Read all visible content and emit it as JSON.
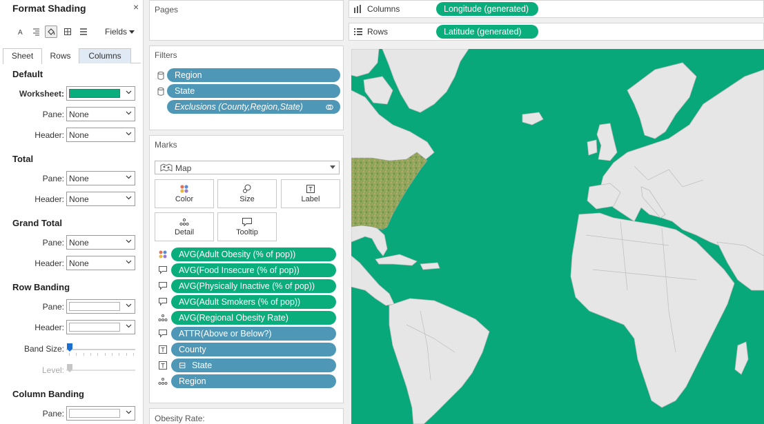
{
  "format_pane": {
    "title": "Format Shading",
    "close_symbol": "×",
    "toolbar": {
      "icons": [
        "font-icon",
        "alignment-icon",
        "shading-icon",
        "borders-icon",
        "lines-icon"
      ],
      "fields_label": "Fields"
    },
    "tabs": [
      "Sheet",
      "Rows",
      "Columns"
    ],
    "active_tab": "Sheet",
    "sections": {
      "default": {
        "title": "Default",
        "worksheet_label": "Worksheet:",
        "worksheet_color": "#0aae7c",
        "pane_label": "Pane:",
        "pane_value": "None",
        "header_label": "Header:",
        "header_value": "None"
      },
      "total": {
        "title": "Total",
        "pane_label": "Pane:",
        "pane_value": "None",
        "header_label": "Header:",
        "header_value": "None"
      },
      "grand_total": {
        "title": "Grand Total",
        "pane_label": "Pane:",
        "pane_value": "None",
        "header_label": "Header:",
        "header_value": "None"
      },
      "row_banding": {
        "title": "Row Banding",
        "pane_label": "Pane:",
        "header_label": "Header:",
        "band_size_label": "Band Size:",
        "level_label": "Level:"
      },
      "column_banding": {
        "title": "Column Banding",
        "pane_label": "Pane:"
      }
    }
  },
  "pages": {
    "title": "Pages"
  },
  "filters": {
    "title": "Filters",
    "items": [
      {
        "label": "Region",
        "icon": "database-icon"
      },
      {
        "label": "State",
        "icon": "database-icon"
      },
      {
        "label": "Exclusions (County,Region,State)",
        "icon": "set-icon"
      }
    ]
  },
  "marks": {
    "title": "Marks",
    "mark_type": "Map",
    "buttons": [
      "Color",
      "Size",
      "Label",
      "Detail",
      "Tooltip"
    ],
    "fields": [
      {
        "label": "AVG(Adult Obesity (% of pop))",
        "role": "color",
        "kind": "measure"
      },
      {
        "label": "AVG(Food Insecure (% of pop))",
        "role": "tooltip",
        "kind": "measure"
      },
      {
        "label": "AVG(Physically Inactive (% of pop))",
        "role": "tooltip",
        "kind": "measure"
      },
      {
        "label": "AVG(Adult Smokers (% of pop))",
        "role": "tooltip",
        "kind": "measure"
      },
      {
        "label": "AVG(Regional Obesity Rate)",
        "role": "detail",
        "kind": "measure"
      },
      {
        "label": "ATTR(Above or Below?)",
        "role": "tooltip",
        "kind": "dimension"
      },
      {
        "label": "County",
        "role": "label",
        "kind": "dimension"
      },
      {
        "label": "State",
        "role": "label",
        "kind": "dimension",
        "prefix": "⊟"
      },
      {
        "label": "Region",
        "role": "detail",
        "kind": "dimension"
      }
    ]
  },
  "legend": {
    "title": "Obesity Rate:"
  },
  "columns_shelf": {
    "label": "Columns",
    "pill": "Longitude (generated)"
  },
  "rows_shelf": {
    "label": "Rows",
    "pill": "Latitude (generated)"
  },
  "colors": {
    "worksheet_shading": "#0aae7c",
    "measure_pill": "#0aae7c",
    "dimension_pill": "#4f97b6",
    "land": "#e6e6e6",
    "water": "#09a87a"
  }
}
